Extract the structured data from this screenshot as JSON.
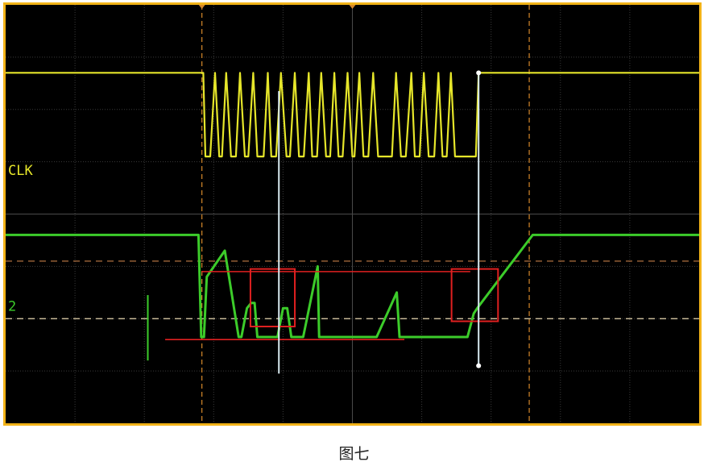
{
  "chart_data": {
    "type": "line",
    "title": "",
    "xlabel": "",
    "ylabel": "",
    "grid": true,
    "xlim": [
      0,
      10
    ],
    "ylim": [
      0,
      8
    ],
    "series": [
      {
        "name": "CLK",
        "color": "#e6e62a",
        "x": [
          0,
          2.85,
          2.88,
          2.95,
          3.02,
          3.08,
          3.12,
          3.18,
          3.25,
          3.32,
          3.38,
          3.45,
          3.5,
          3.57,
          3.63,
          3.72,
          3.78,
          3.83,
          3.9,
          3.97,
          4.05,
          4.1,
          4.17,
          4.23,
          4.3,
          4.37,
          4.42,
          4.49,
          4.55,
          4.62,
          4.68,
          4.74,
          4.8,
          4.86,
          4.93,
          5.0,
          5.03,
          5.1,
          5.16,
          5.23,
          5.3,
          5.37,
          5.57,
          5.63,
          5.7,
          5.77,
          5.85,
          5.9,
          5.97,
          6.03,
          6.1,
          6.18,
          6.24,
          6.3,
          6.36,
          6.42,
          6.48,
          6.55,
          6.78,
          6.82,
          10
        ],
        "y": [
          6.7,
          6.7,
          5.1,
          5.1,
          6.7,
          5.1,
          5.1,
          6.7,
          5.1,
          5.1,
          6.7,
          5.1,
          5.1,
          6.7,
          5.1,
          5.1,
          6.7,
          5.1,
          5.1,
          6.7,
          5.1,
          5.1,
          6.7,
          5.1,
          5.1,
          6.7,
          5.1,
          5.1,
          6.7,
          5.1,
          5.1,
          6.7,
          5.1,
          5.1,
          6.7,
          5.1,
          5.1,
          6.7,
          5.1,
          5.1,
          6.7,
          5.1,
          5.1,
          6.7,
          5.1,
          5.1,
          6.7,
          5.1,
          5.1,
          6.7,
          5.1,
          5.1,
          6.7,
          5.1,
          5.1,
          6.7,
          5.1,
          5.1,
          5.1,
          6.7,
          6.7
        ]
      },
      {
        "name": "2",
        "color": "#3ccc2a",
        "x": [
          0,
          2.78,
          2.82,
          2.86,
          2.9,
          3.16,
          3.36,
          3.4,
          3.48,
          3.54,
          3.59,
          3.63,
          3.78,
          3.92,
          4.0,
          4.06,
          4.12,
          4.29,
          4.5,
          4.52,
          4.74,
          4.86,
          5.28,
          5.33,
          5.35,
          5.64,
          5.68,
          5.7,
          6.64,
          6.66,
          6.75,
          6.8,
          7.6,
          10
        ],
        "y": [
          3.6,
          3.6,
          1.65,
          1.65,
          2.8,
          3.3,
          1.65,
          1.65,
          2.2,
          2.3,
          2.3,
          1.65,
          1.65,
          1.65,
          2.2,
          2.2,
          1.65,
          1.65,
          3.0,
          1.65,
          1.65,
          1.65,
          1.65,
          1.65,
          1.65,
          2.5,
          1.65,
          1.65,
          1.65,
          1.65,
          2.1,
          2.2,
          3.6,
          3.6
        ]
      }
    ],
    "channel_labels": {
      "clk": "CLK",
      "ch2": "2"
    },
    "annotations": {
      "cursor_vertical_x": [
        3.94,
        6.82
      ],
      "cursor_color": "#d8eaf0",
      "threshold_lines_y": [
        3.1,
        2.0
      ],
      "reference_lines_y": [
        2.9,
        1.6
      ],
      "highlight_boxes": [
        {
          "x": [
            3.53,
            4.17
          ],
          "y": [
            1.85,
            2.95
          ]
        },
        {
          "x": [
            6.43,
            7.1
          ],
          "y": [
            1.95,
            2.95
          ]
        }
      ],
      "highlight_color": "#e02020",
      "trigger_time_x": [
        2.83,
        7.55
      ]
    }
  },
  "figure_caption": "图七",
  "colors": {
    "frame": "#f2b318",
    "background": "#000000",
    "grid": "#3a3a3a",
    "time_marker": "#d6882a",
    "threshold": "#b8a060"
  }
}
